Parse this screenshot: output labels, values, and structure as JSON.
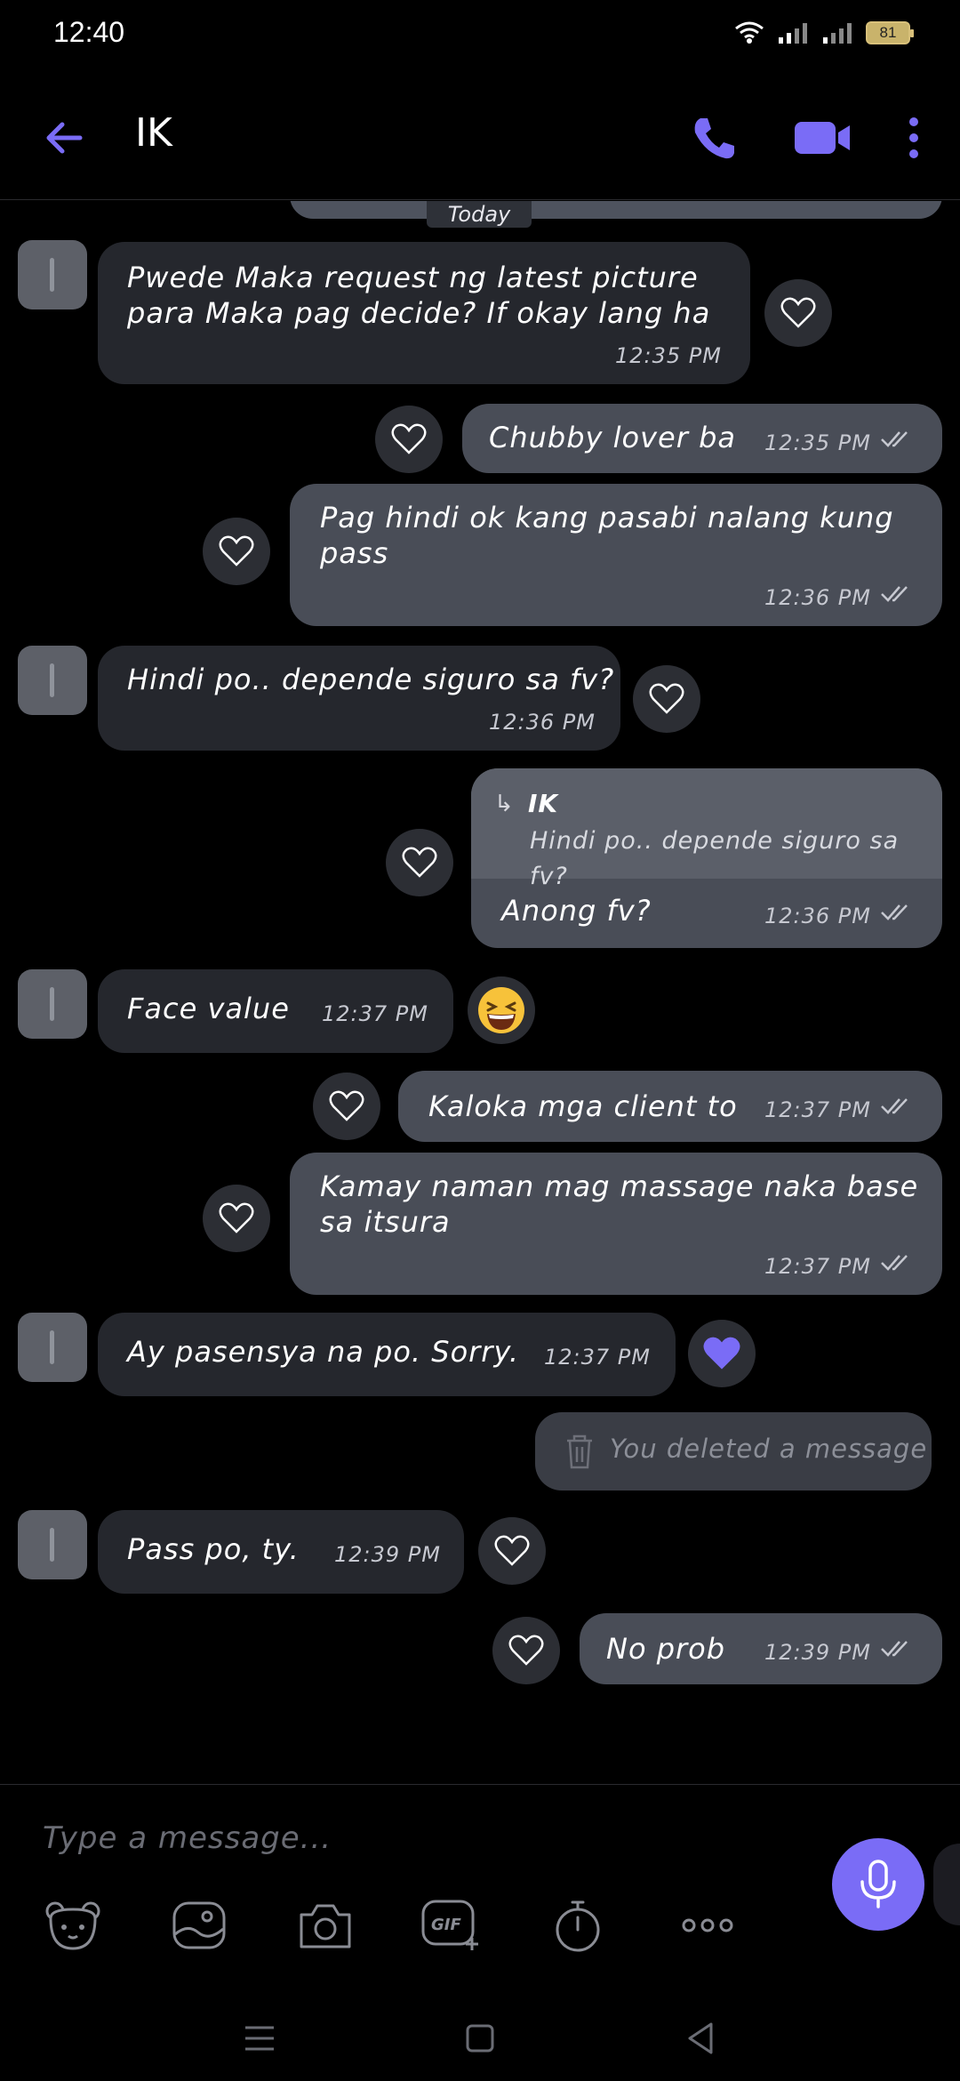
{
  "status": {
    "time": "12:40",
    "battery": "81"
  },
  "header": {
    "contact_name": "IK"
  },
  "chat": {
    "date_divider": "Today",
    "messages": [
      {
        "dir": "in",
        "lines": [
          "Pwede Maka request ng latest picture",
          "para Maka pag decide? If okay lang ha"
        ],
        "time": "12:35 PM"
      },
      {
        "dir": "out",
        "lines": [
          "Chubby lover ba"
        ],
        "time": "12:35 PM"
      },
      {
        "dir": "out",
        "lines": [
          "Pag hindi ok kang pasabi nalang kung",
          "pass"
        ],
        "time": "12:36 PM"
      },
      {
        "dir": "in",
        "lines": [
          "Hindi po.. depende siguro sa fv?"
        ],
        "time": "12:36 PM"
      },
      {
        "dir": "out",
        "reply_to": {
          "name": "IK",
          "text": "Hindi po.. depende siguro sa fv?"
        },
        "lines": [
          "Anong fv?"
        ],
        "time": "12:36 PM"
      },
      {
        "dir": "in",
        "lines": [
          "Face value"
        ],
        "time": "12:37 PM",
        "reaction": "grinning-squinting-face"
      },
      {
        "dir": "out",
        "lines": [
          "Kaloka mga client to"
        ],
        "time": "12:37 PM"
      },
      {
        "dir": "out",
        "lines": [
          "Kamay naman mag massage naka base",
          "sa itsura"
        ],
        "time": "12:37 PM"
      },
      {
        "dir": "in",
        "lines": [
          "Ay pasensya na po. Sorry."
        ],
        "time": "12:37 PM",
        "reaction": "purple-heart"
      },
      {
        "dir": "out",
        "deleted": true,
        "lines": [
          "You deleted a message"
        ]
      },
      {
        "dir": "in",
        "lines": [
          "Pass po, ty."
        ],
        "time": "12:39 PM"
      },
      {
        "dir": "out",
        "lines": [
          "No prob"
        ],
        "time": "12:39 PM"
      }
    ]
  },
  "composer": {
    "placeholder": "Type a message..."
  },
  "colors": {
    "accent": "#7a6cf6",
    "incoming_bubble": "#25272d",
    "outgoing_bubble": "#494d57",
    "background": "#000000"
  },
  "icons": [
    "back-arrow-icon",
    "phone-icon",
    "video-camera-icon",
    "more-vertical-icon",
    "heart-icon",
    "trash-icon",
    "microphone-icon",
    "sticker-bear-icon",
    "gallery-icon",
    "camera-icon",
    "gif-icon",
    "timer-icon",
    "more-horizontal-icon"
  ]
}
